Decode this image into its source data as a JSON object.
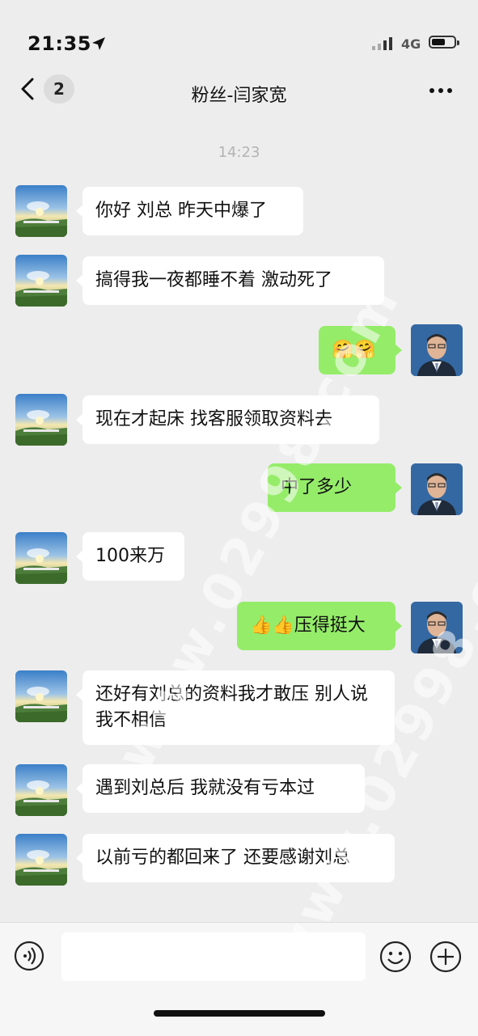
{
  "status_bar": {
    "time": "21:35",
    "network": "4G"
  },
  "nav": {
    "unread_count": "2",
    "title": "粉丝-闫家宽"
  },
  "timestamp": "14:23",
  "messages": [
    {
      "side": "in",
      "text": "你好 刘总 昨天中爆了"
    },
    {
      "side": "in",
      "text": "搞得我一夜都睡不着  激动死了"
    },
    {
      "side": "out",
      "text": "🤗🤗"
    },
    {
      "side": "in",
      "text": "现在才起床 找客服领取资料去"
    },
    {
      "side": "out",
      "text": "中了多少"
    },
    {
      "side": "in",
      "text": "100来万"
    },
    {
      "side": "out",
      "text": "👍👍压得挺大"
    },
    {
      "side": "in",
      "text": "还好有刘总的资料我才敢压  别人说我不相信"
    },
    {
      "side": "in",
      "text": "遇到刘总后  我就没有亏本过"
    },
    {
      "side": "in",
      "text": "以前亏的都回来了 还要感谢刘总"
    }
  ],
  "watermark": "www.02998.com",
  "colors": {
    "outgoing_bubble": "#95ec69",
    "incoming_bubble": "#ffffff",
    "background": "#ededed"
  },
  "icons": [
    "location-arrow-icon",
    "signal-icon",
    "battery-icon",
    "back-chevron-icon",
    "more-icon",
    "voice-icon",
    "emoji-icon",
    "plus-icon"
  ]
}
